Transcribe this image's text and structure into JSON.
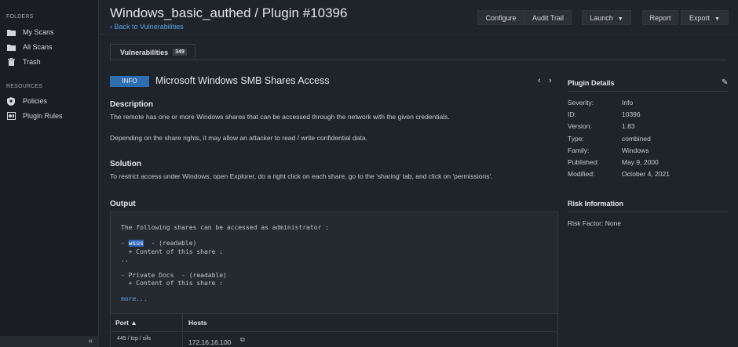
{
  "sidebar": {
    "folders_heading": "FOLDERS",
    "folders": [
      {
        "label": "My Scans",
        "icon": "folder-icon"
      },
      {
        "label": "All Scans",
        "icon": "folder-icon"
      },
      {
        "label": "Trash",
        "icon": "trash-icon"
      }
    ],
    "resources_heading": "RESOURCES",
    "resources": [
      {
        "label": "Policies",
        "icon": "shield-icon"
      },
      {
        "label": "Plugin Rules",
        "icon": "rules-icon"
      }
    ],
    "collapse": "«"
  },
  "header": {
    "title": "Windows_basic_authed / Plugin #10396",
    "back_link": "Back to Vulnerabilities",
    "buttons": {
      "configure": "Configure",
      "audit_trail": "Audit Trail",
      "launch": "Launch",
      "report": "Report",
      "export": "Export"
    }
  },
  "tabs": {
    "vulnerabilities_label": "Vulnerabilities",
    "vulnerabilities_count": "349"
  },
  "plugin": {
    "severity_badge": "INFO",
    "name": "Microsoft Windows SMB Shares Access",
    "prev": "‹",
    "next": "›"
  },
  "description": {
    "title": "Description",
    "text1": "The remote has one or more Windows shares that can be accessed through the network with the given credentials.",
    "text2": "Depending on the share rights, it may allow an attacker to read / write confidential data."
  },
  "solution": {
    "title": "Solution",
    "text": "To restrict access under Windows, open Explorer, do a right click on each share, go to the 'sharing' tab, and click on 'permissions'."
  },
  "output": {
    "title": "Output",
    "line1": "The following shares can be accessed as administrator :",
    "line2_prefix": "- ",
    "line2_highlight": "wsus",
    "line2_suffix": "  - (readable)",
    "line3": "  + Content of this share :",
    "line4": "..",
    "line5": "- Private Docs  - (readable)",
    "line6": "  + Content of this share :",
    "more": "more...",
    "table": {
      "port_header": "Port ▲",
      "hosts_header": "Hosts",
      "port_value": "445 / tcp / cifs",
      "host_value": "172.16.16.100"
    }
  },
  "plugin_details": {
    "title": "Plugin Details",
    "rows": [
      {
        "label": "Severity:",
        "value": "Info"
      },
      {
        "label": "ID:",
        "value": "10396"
      },
      {
        "label": "Version:",
        "value": "1.83"
      },
      {
        "label": "Type:",
        "value": "combined"
      },
      {
        "label": "Family:",
        "value": "Windows"
      },
      {
        "label": "Published:",
        "value": "May 9, 2000"
      },
      {
        "label": "Modified:",
        "value": "October 4, 2021"
      }
    ]
  },
  "risk_information": {
    "title": "Risk Information",
    "risk_factor": "Risk Factor: None"
  },
  "colors": {
    "accent": "#2f6fb0",
    "link": "#5aa2e0",
    "background": "#1f232a"
  }
}
